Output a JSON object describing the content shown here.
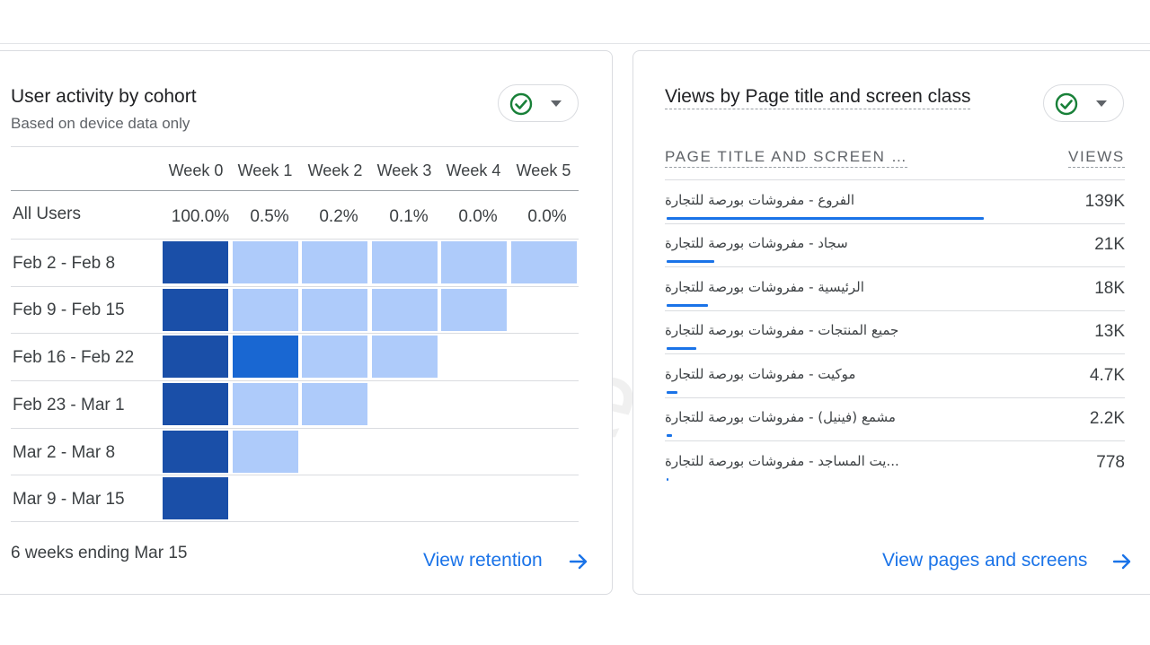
{
  "cohort_card": {
    "title": "User activity by cohort",
    "subtitle": "Based on device data only",
    "weeks": [
      "Week 0",
      "Week 1",
      "Week 2",
      "Week 3",
      "Week 4",
      "Week 5"
    ],
    "all_users_label": "All Users",
    "all_users_values": [
      "100.0%",
      "0.5%",
      "0.2%",
      "0.1%",
      "0.0%",
      "0.0%"
    ],
    "rows": [
      {
        "label": "Feb 2 - Feb 8",
        "cells": 6
      },
      {
        "label": "Feb 9 - Feb 15",
        "cells": 5
      },
      {
        "label": "Feb 16 - Feb 22",
        "cells": 4
      },
      {
        "label": "Feb 23 - Mar 1",
        "cells": 3
      },
      {
        "label": "Mar 2 - Mar 8",
        "cells": 2
      },
      {
        "label": "Mar 9 - Mar 15",
        "cells": 1
      }
    ],
    "highlight_cell": {
      "row": 2,
      "week": 1
    },
    "footer": "6 weeks ending Mar 15",
    "link": "View retention",
    "colors": {
      "week0": "#1a4fa8",
      "light": "#aecbfa",
      "highlight": "#1967d2"
    }
  },
  "pages_card": {
    "title": "Views by Page title and screen class",
    "col_page": "PAGE TITLE AND SCREEN …",
    "col_views": "VIEWS",
    "rows": [
      {
        "name": "الفروع - مفروشات بورصة للتجارة",
        "views": "139K",
        "bar_fraction": 1.0
      },
      {
        "name": "سجاد - مفروشات بورصة للتجارة",
        "views": "21K",
        "bar_fraction": 0.151
      },
      {
        "name": "الرئيسية - مفروشات بورصة للتجارة",
        "views": "18K",
        "bar_fraction": 0.13
      },
      {
        "name": "جميع المنتجات - مفروشات بورصة للتجارة",
        "views": "13K",
        "bar_fraction": 0.094
      },
      {
        "name": "موكيت - مفروشات بورصة للتجارة",
        "views": "4.7K",
        "bar_fraction": 0.034
      },
      {
        "name": "مشمع (فينيل) - مفروشات بورصة للتجارة",
        "views": "2.2K",
        "bar_fraction": 0.016
      },
      {
        "name": "...يت المساجد - مفروشات بورصة للتجارة",
        "views": "778",
        "bar_fraction": 0.006
      }
    ],
    "link": "View pages and screens",
    "colors": {
      "bar": "#1a73e8",
      "check": "#188038"
    }
  },
  "watermark": "Mohamed nageh"
}
